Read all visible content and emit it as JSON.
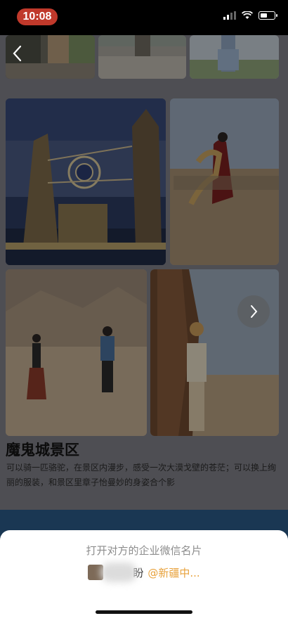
{
  "status_bar": {
    "time": "10:08",
    "battery_level": 0.5
  },
  "icons": {
    "back": "chevron-left-icon",
    "next": "chevron-right-icon",
    "signal": "signal-icon",
    "wifi": "wifi-icon",
    "battery": "battery-icon"
  },
  "photos": {
    "top_row": [
      "photo-thumbnail-1",
      "photo-thumbnail-2",
      "photo-thumbnail-3"
    ],
    "gallery": [
      "gate-landmark-photo",
      "dancer-red-dress-photo",
      "couple-walking-photo",
      "woman-by-rock-photo"
    ]
  },
  "scenic_area": {
    "title": "魔鬼城景区",
    "description": "可以骑一匹骆驼，在景区内漫步，感受一次大漠戈壁的苍茫；可以换上绚丽的服装，和景区里章子怡曼妙的身姿合个影"
  },
  "bottom_sheet": {
    "prompt": "打开对方的企业微信名片",
    "contact_name": "盼",
    "company": "@新疆中..."
  },
  "colors": {
    "time_pill": "#c0392b",
    "company_text": "#e8a23c",
    "blue_band": "#2b5a86"
  }
}
